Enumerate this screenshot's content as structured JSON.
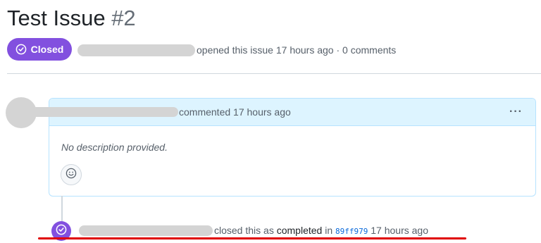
{
  "issue": {
    "title": "Test Issue",
    "number": "#2",
    "status": "Closed",
    "opened_text": "opened this issue 17 hours ago · 0 comments"
  },
  "comment": {
    "header_text": "commented 17 hours ago",
    "menu_label": "···",
    "body": "No description provided."
  },
  "timeline": {
    "event_prefix": "closed this as",
    "event_reason": "completed",
    "event_in": "in",
    "commit_sha": "89ff979",
    "event_time": "17 hours ago"
  },
  "colors": {
    "closed_purple": "#8250df",
    "comment_header_bg": "#ddf4ff",
    "annotation_red": "#e00000",
    "link_blue": "#0969da"
  },
  "icons": [
    "check-circle-icon",
    "smiley-icon",
    "kebab-menu-icon"
  ]
}
